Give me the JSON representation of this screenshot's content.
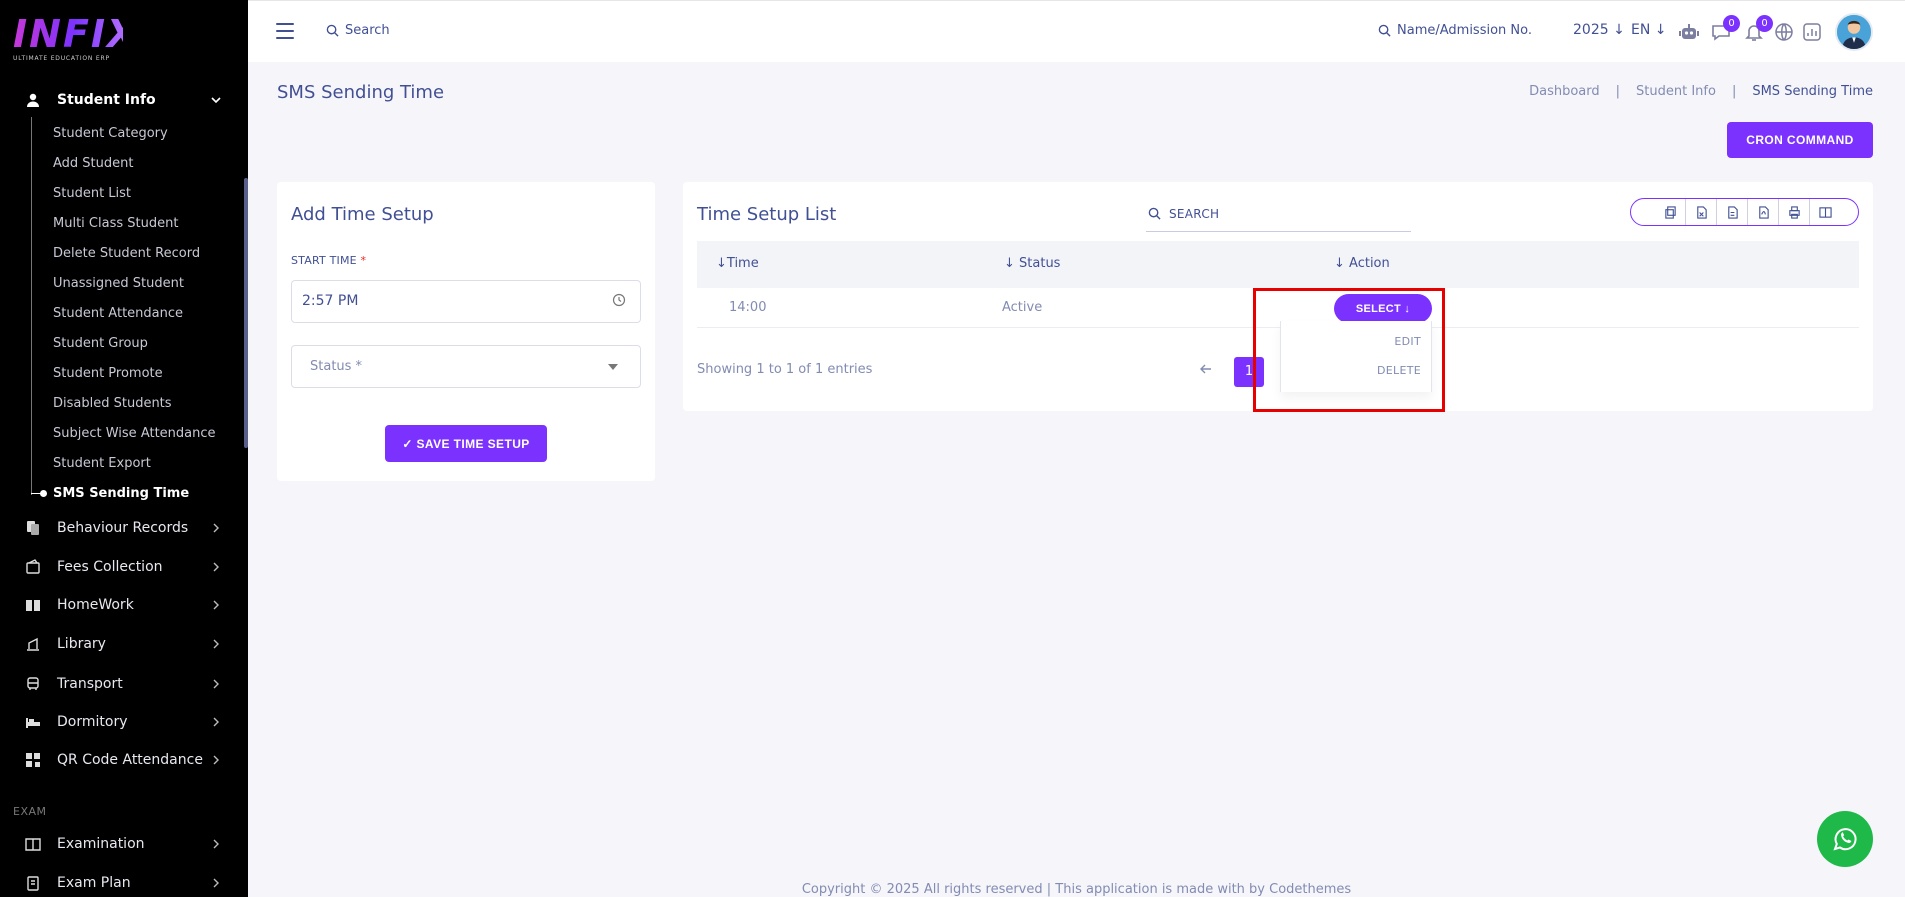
{
  "brand": {
    "logo": "INFIX",
    "tagline": "ULTIMATE EDUCATION ERP"
  },
  "header": {
    "search_label": "Search",
    "name_search_label": "Name/Admission No.",
    "year": "2025",
    "language": "EN",
    "messages_count": "0",
    "notifications_count": "0"
  },
  "sidebar": {
    "active_group": "Student Info",
    "student_info_items": [
      "Student Category",
      "Add Student",
      "Student List",
      "Multi Class Student",
      "Delete Student Record",
      "Unassigned Student",
      "Student Attendance",
      "Student Group",
      "Student Promote",
      "Disabled Students",
      "Subject Wise Attendance",
      "Student Export",
      "SMS Sending Time"
    ],
    "groups": [
      "Behaviour Records",
      "Fees Collection",
      "HomeWork",
      "Library",
      "Transport",
      "Dormitory",
      "QR Code Attendance"
    ],
    "section_exam": "EXAM",
    "exam_groups": [
      "Examination",
      "Exam Plan"
    ]
  },
  "page": {
    "title": "SMS Sending Time",
    "breadcrumb": [
      "Dashboard",
      "Student Info",
      "SMS Sending Time"
    ],
    "cron_button": "CRON COMMAND"
  },
  "add_form": {
    "title": "Add Time Setup",
    "start_time_label": "START TIME",
    "required_mark": "*",
    "start_time_value": "2:57 PM",
    "status_placeholder": "Status *",
    "save_button": "SAVE TIME SETUP"
  },
  "list": {
    "title": "Time Setup List",
    "search_placeholder": "SEARCH",
    "columns": [
      "Time",
      "Status",
      "Action"
    ],
    "rows": [
      {
        "time": "14:00",
        "status": "Active"
      }
    ],
    "select_button": "SELECT",
    "actions": [
      "EDIT",
      "DELETE"
    ],
    "showing": "Showing 1 to 1 of 1 entries",
    "current_page": "1"
  },
  "footer": "Copyright © 2025 All rights reserved | This application is made with by Codethemes",
  "colors": {
    "primary": "#7c32ff",
    "text": "#415094",
    "highlight": "#e60000"
  }
}
